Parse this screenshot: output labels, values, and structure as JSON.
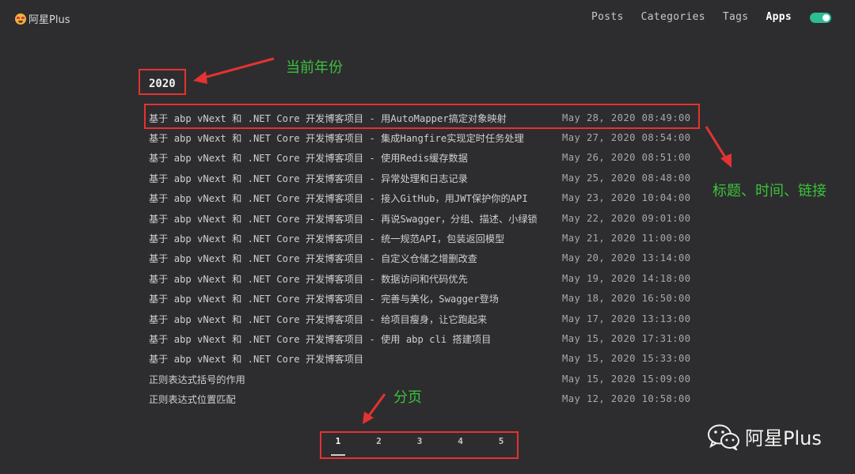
{
  "header": {
    "brand": "阿星Plus",
    "nav": [
      "Posts",
      "Categories",
      "Tags",
      "Apps"
    ],
    "active_nav": "Apps"
  },
  "year": "2020",
  "posts": [
    {
      "title": "基于 abp vNext 和 .NET Core 开发博客项目 - 用AutoMapper搞定对象映射",
      "time": "May 28, 2020 08:49:00"
    },
    {
      "title": "基于 abp vNext 和 .NET Core 开发博客项目 - 集成Hangfire实现定时任务处理",
      "time": "May 27, 2020 08:54:00"
    },
    {
      "title": "基于 abp vNext 和 .NET Core 开发博客项目 - 使用Redis缓存数据",
      "time": "May 26, 2020 08:51:00"
    },
    {
      "title": "基于 abp vNext 和 .NET Core 开发博客项目 - 异常处理和日志记录",
      "time": "May 25, 2020 08:48:00"
    },
    {
      "title": "基于 abp vNext 和 .NET Core 开发博客项目 - 接入GitHub，用JWT保护你的API",
      "time": "May 23, 2020 10:04:00"
    },
    {
      "title": "基于 abp vNext 和 .NET Core 开发博客项目 - 再说Swagger，分组、描述、小绿锁",
      "time": "May 22, 2020 09:01:00"
    },
    {
      "title": "基于 abp vNext 和 .NET Core 开发博客项目 - 统一规范API，包装返回模型",
      "time": "May 21, 2020 11:00:00"
    },
    {
      "title": "基于 abp vNext 和 .NET Core 开发博客项目 - 自定义仓储之增删改查",
      "time": "May 20, 2020 13:14:00"
    },
    {
      "title": "基于 abp vNext 和 .NET Core 开发博客项目 - 数据访问和代码优先",
      "time": "May 19, 2020 14:18:00"
    },
    {
      "title": "基于 abp vNext 和 .NET Core 开发博客项目 - 完善与美化，Swagger登场",
      "time": "May 18, 2020 16:50:00"
    },
    {
      "title": "基于 abp vNext 和 .NET Core 开发博客项目 - 给项目瘦身，让它跑起来",
      "time": "May 17, 2020 13:13:00"
    },
    {
      "title": "基于 abp vNext 和 .NET Core 开发博客项目 - 使用 abp cli 搭建项目",
      "time": "May 15, 2020 17:31:00"
    },
    {
      "title": "基于 abp vNext 和 .NET Core 开发博客项目",
      "time": "May 15, 2020 15:33:00"
    },
    {
      "title": "正则表达式括号的作用",
      "time": "May 15, 2020 15:09:00"
    },
    {
      "title": "正则表达式位置匹配",
      "time": "May 12, 2020 10:58:00"
    }
  ],
  "pagination": {
    "pages": [
      "1",
      "2",
      "3",
      "4",
      "5"
    ],
    "current": "1"
  },
  "annotations": {
    "year": "当前年份",
    "row": "标题、时间、链接",
    "pager": "分页"
  },
  "watermark": "阿星Plus",
  "colors": {
    "background": "#2d2d2f",
    "toggle": "#2dbd95",
    "highlight_box": "#e53232",
    "annotation": "#3bc23b"
  },
  "icons": {
    "brand": "star-struck-emoji-icon",
    "watermark": "wechat-icon"
  }
}
